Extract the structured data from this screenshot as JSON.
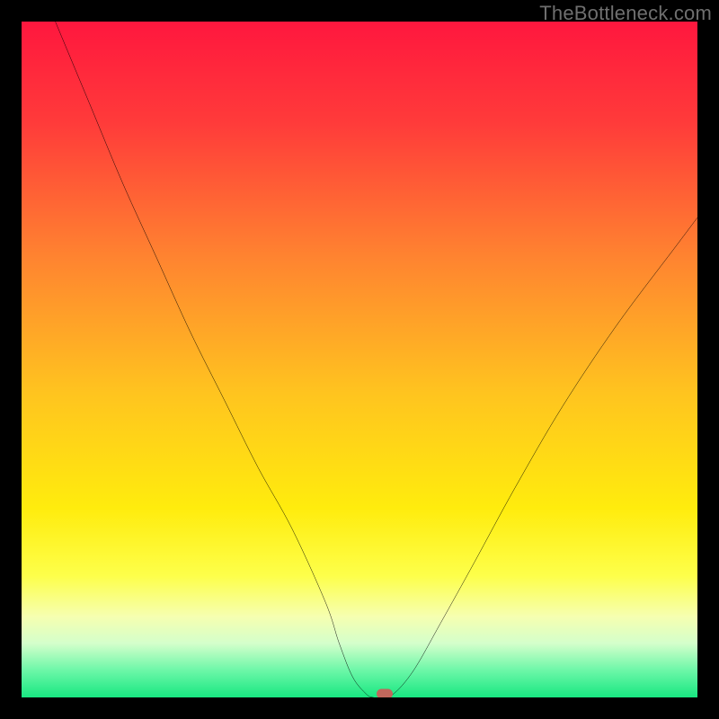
{
  "watermark": {
    "text": "TheBottleneck.com"
  },
  "chart_data": {
    "type": "line",
    "title": "",
    "xlabel": "",
    "ylabel": "",
    "xlim": [
      0,
      100
    ],
    "ylim": [
      0,
      100
    ],
    "grid": false,
    "legend": false,
    "series": [
      {
        "name": "bottleneck-curve",
        "x": [
          5,
          10,
          15,
          20,
          25,
          30,
          35,
          40,
          45,
          47,
          49,
          51,
          52,
          53,
          55,
          58,
          62,
          67,
          73,
          80,
          88,
          97,
          100
        ],
        "y": [
          100,
          88,
          76,
          65,
          54,
          44,
          34,
          25,
          14,
          8,
          3,
          0.5,
          0,
          0,
          0.5,
          4,
          11,
          20,
          31,
          43,
          55,
          67,
          71
        ]
      }
    ],
    "markers": [
      {
        "name": "minimum-marker",
        "x": 53.7,
        "y": 0.5,
        "color": "#c1675c"
      }
    ],
    "background_gradient": {
      "stops": [
        {
          "offset": 0.0,
          "color": "#ff173e"
        },
        {
          "offset": 0.15,
          "color": "#ff3b3a"
        },
        {
          "offset": 0.35,
          "color": "#ff8430"
        },
        {
          "offset": 0.55,
          "color": "#ffc41f"
        },
        {
          "offset": 0.72,
          "color": "#ffec0d"
        },
        {
          "offset": 0.82,
          "color": "#fdff4a"
        },
        {
          "offset": 0.88,
          "color": "#f6ffb0"
        },
        {
          "offset": 0.92,
          "color": "#d4ffcb"
        },
        {
          "offset": 0.96,
          "color": "#6cf7a8"
        },
        {
          "offset": 1.0,
          "color": "#18e781"
        }
      ]
    }
  }
}
